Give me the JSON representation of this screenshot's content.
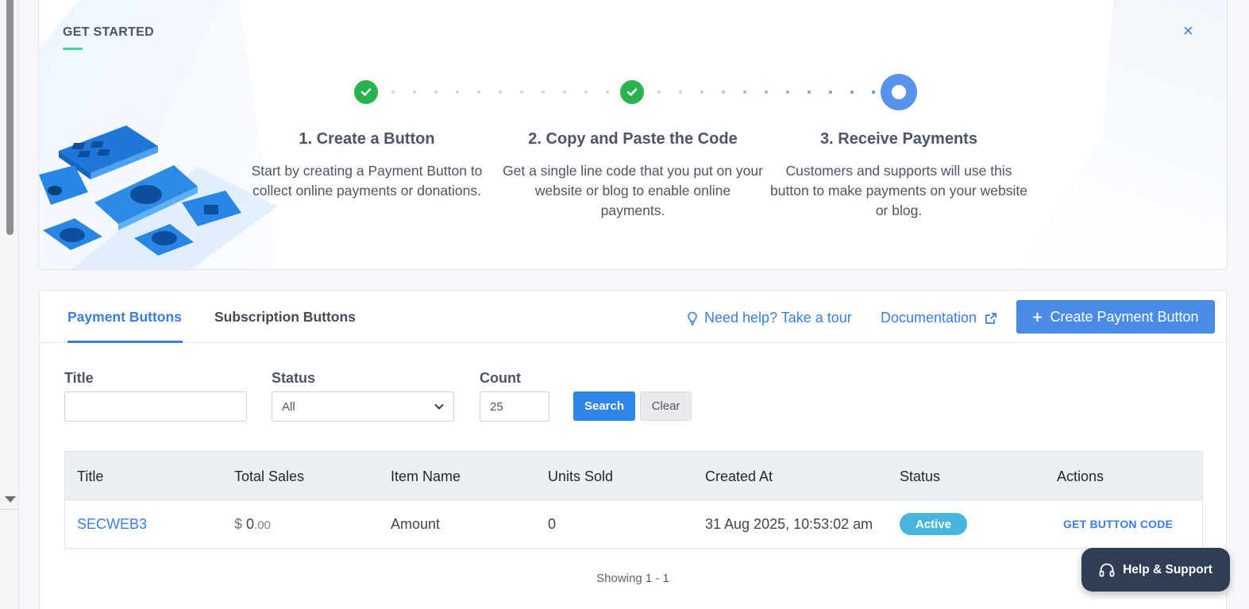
{
  "get_started": {
    "title": "GET STARTED",
    "close_glyph": "×",
    "steps": [
      {
        "heading": "1. Create a Button",
        "text": "Start by creating a Payment Button to collect online payments or donations.",
        "state": "done"
      },
      {
        "heading": "2. Copy and Paste the Code",
        "text": "Get a single line code that you put on your website or blog to enable online payments.",
        "state": "done"
      },
      {
        "heading": "3. Receive Payments",
        "text": "Customers and supports will use this button to make payments on your website or blog.",
        "state": "current"
      }
    ]
  },
  "tabs": [
    {
      "label": "Payment Buttons",
      "active": true
    },
    {
      "label": "Subscription Buttons",
      "active": false
    }
  ],
  "toolbar": {
    "help_label": "Need help? Take a tour",
    "docs_label": "Documentation",
    "create_label": "Create Payment Button"
  },
  "filters": {
    "title_label": "Title",
    "title_value": "",
    "status_label": "Status",
    "status_value": "All",
    "count_label": "Count",
    "count_value": "25",
    "search_label": "Search",
    "clear_label": "Clear"
  },
  "table": {
    "columns": [
      "Title",
      "Total Sales",
      "Item Name",
      "Units Sold",
      "Created At",
      "Status",
      "Actions"
    ],
    "rows": [
      {
        "title": "SECWEB3",
        "sales_currency": "$",
        "sales_whole": "0",
        "sales_cents": ".00",
        "item_name": "Amount",
        "units_sold": "0",
        "created_at": "31 Aug 2025, 10:53:02 am",
        "status": "Active",
        "action": "GET BUTTON CODE"
      }
    ]
  },
  "pagination": {
    "showing": "Showing 1 - 1"
  },
  "support": {
    "label": "Help & Support"
  },
  "colors": {
    "accent": "#3b7fdc",
    "success": "#27b34e",
    "badge": "#48b6dc",
    "support_bg": "#2f3e55"
  }
}
